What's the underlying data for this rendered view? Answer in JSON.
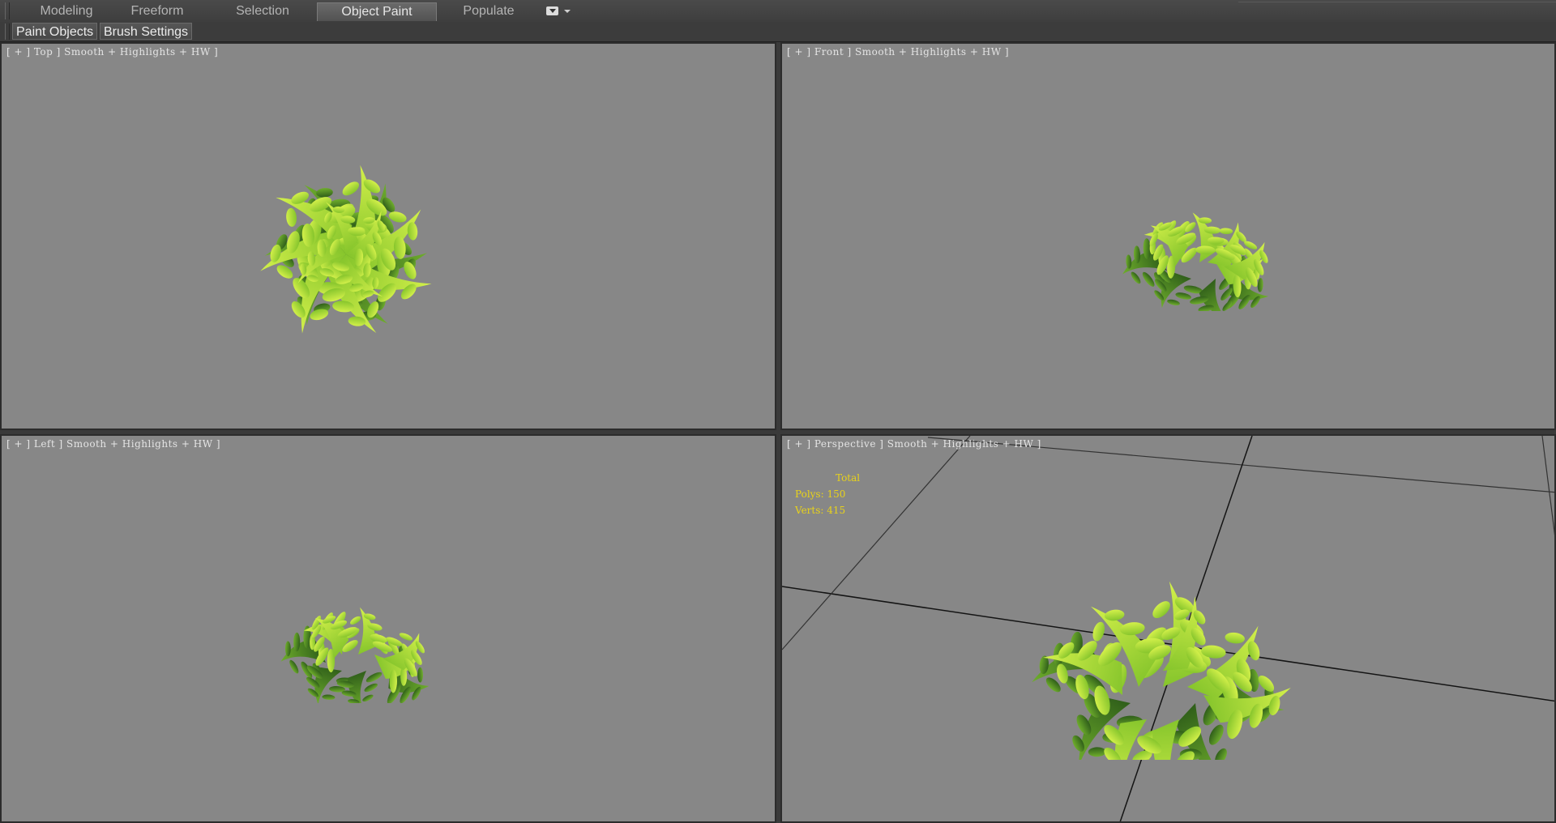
{
  "ribbon": {
    "tabs": [
      {
        "label": "Modeling",
        "active": false
      },
      {
        "label": "Freeform",
        "active": false
      },
      {
        "label": "Selection",
        "active": false
      },
      {
        "label": "Object Paint",
        "active": true
      },
      {
        "label": "Populate",
        "active": false
      }
    ],
    "options_icon": "ribbon-options-icon"
  },
  "subtoolbar": {
    "paint_objects": "Paint Objects",
    "brush_settings": "Brush Settings"
  },
  "viewports": {
    "top": {
      "label": "[ + ] Top ] Smooth + Highlights + HW ]"
    },
    "front": {
      "label": "[ + ] Front ] Smooth + Highlights + HW ]"
    },
    "left": {
      "label": "[ + ] Left ] Smooth + Highlights + HW ]"
    },
    "perspective": {
      "label": "[ + ] Perspective ] Smooth + Highlights + HW ]"
    }
  },
  "stats": {
    "total": "Total",
    "polys": "Polys: 150",
    "verts": "Verts: 415"
  },
  "colors": {
    "viewport_bg": "#878787",
    "stats_text": "#e8d21a",
    "leaf_light": "#b6e33a",
    "leaf_dark": "#3f7a22"
  }
}
